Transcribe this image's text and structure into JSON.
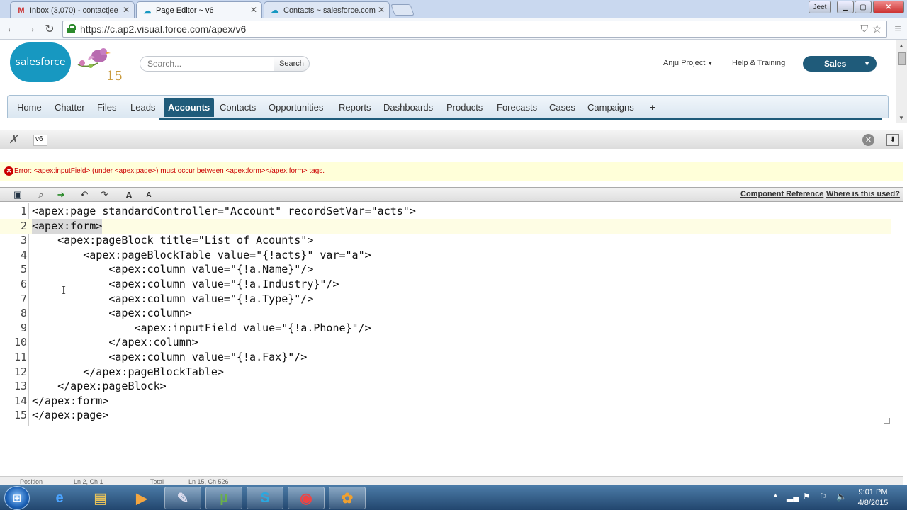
{
  "browser": {
    "tabs": [
      {
        "title": "Inbox (3,070) - contactjee",
        "icon": "gmail-icon"
      },
      {
        "title": "Page Editor ~ v6",
        "icon": "salesforce-cloud-icon"
      },
      {
        "title": "Contacts ~ salesforce.com",
        "icon": "salesforce-cloud-icon"
      }
    ],
    "user_badge": "Jeet",
    "url": "https://c.ap2.visual.force.com/apex/v6"
  },
  "sf_header": {
    "logo_text": "salesforce",
    "badge_number": "15",
    "search_placeholder": "Search...",
    "search_button": "Search",
    "user_menu": "Anju Project",
    "help_link": "Help & Training",
    "app_switcher": "Sales"
  },
  "sf_nav": {
    "tabs": [
      "Home",
      "Chatter",
      "Files",
      "Leads",
      "Accounts",
      "Contacts",
      "Opportunities",
      "Reports",
      "Dashboards",
      "Products",
      "Forecasts",
      "Cases",
      "Campaigns",
      "+"
    ],
    "active": "Accounts"
  },
  "dev_panel": {
    "page_name": "v6",
    "error": "Error: <apex:inputField> (under <apex:page>) must occur between <apex:form></apex:form> tags.",
    "links": {
      "component_reference": "Component Reference",
      "where_used": "Where is this used?"
    }
  },
  "editor": {
    "lines": [
      {
        "n": "1",
        "code": "<apex:page standardController=\"Account\" recordSetVar=\"acts\">"
      },
      {
        "n": "2",
        "code": "<apex:form>"
      },
      {
        "n": "3",
        "code": "    <apex:pageBlock title=\"List of Acounts\">"
      },
      {
        "n": "4",
        "code": "        <apex:pageBlockTable value=\"{!acts}\" var=\"a\">"
      },
      {
        "n": "5",
        "code": "            <apex:column value=\"{!a.Name}\"/>"
      },
      {
        "n": "6",
        "code": "            <apex:column value=\"{!a.Industry}\"/>"
      },
      {
        "n": "7",
        "code": "            <apex:column value=\"{!a.Type}\"/>"
      },
      {
        "n": "8",
        "code": "            <apex:column>"
      },
      {
        "n": "9",
        "code": "                <apex:inputField value=\"{!a.Phone}\"/>"
      },
      {
        "n": "10",
        "code": "            </apex:column>"
      },
      {
        "n": "11",
        "code": "            <apex:column value=\"{!a.Fax}\"/>"
      },
      {
        "n": "12",
        "code": "        </apex:pageBlockTable>"
      },
      {
        "n": "13",
        "code": "    </apex:pageBlock>"
      },
      {
        "n": "14",
        "code": "</apex:form>"
      },
      {
        "n": "15",
        "code": "</apex:page>"
      }
    ],
    "highlighted_line": "2",
    "status_position_label": "Position",
    "status_position": "Ln 2, Ch 1",
    "status_total_label": "Total",
    "status_total": "Ln 15, Ch 526"
  },
  "taskbar": {
    "time": "9:01 PM",
    "date": "4/8/2015"
  },
  "colors": {
    "accent": "#1f5b7a",
    "error": "#cc0000",
    "sf_blue": "#1798c1"
  }
}
